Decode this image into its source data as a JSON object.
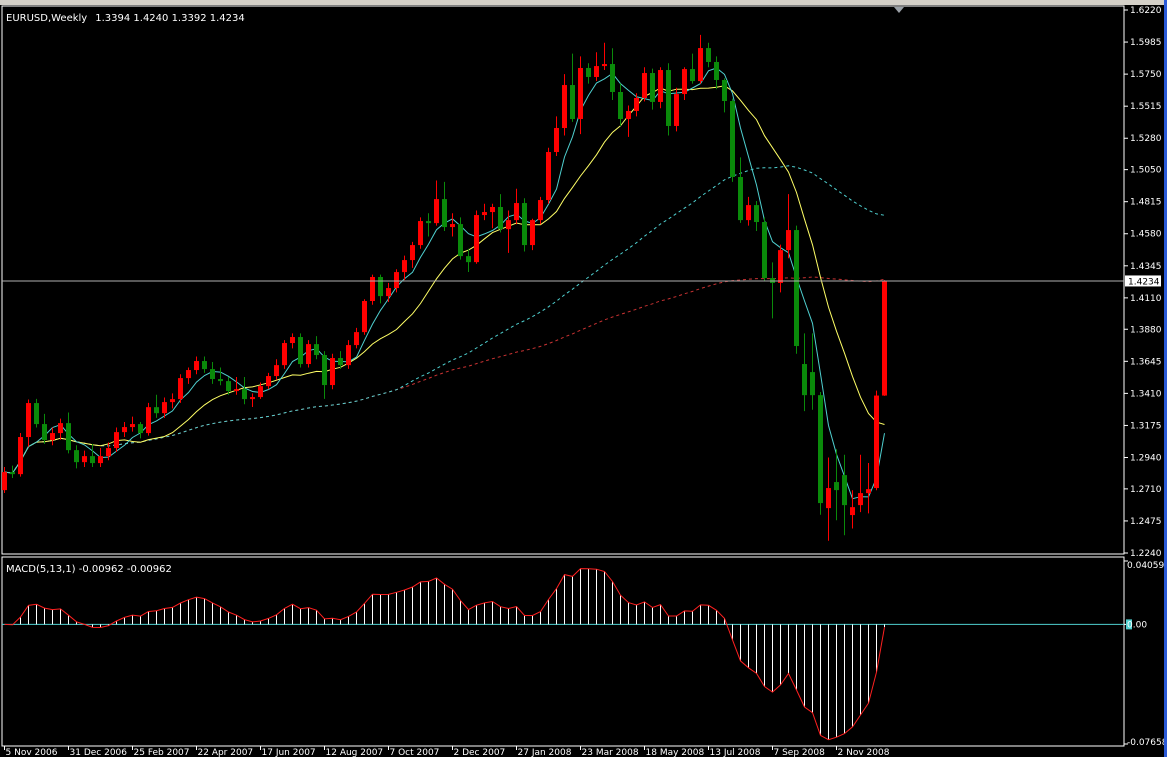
{
  "window": {
    "title_symbol": "EURUSD,Weekly",
    "title_ohlc": "1.3394 1.4240 1.3392 1.4234"
  },
  "colors": {
    "background": "#000000",
    "bull_candle": "#ff0000",
    "bear_candle": "#0a8a0a",
    "ma_fast": "#4fd0d0",
    "ma_medium": "#ffff66",
    "ma_slow_dashed": "#4fd0d0",
    "ma_long_dashed": "#c83232",
    "price_line": "#b0b0b0",
    "macd_histogram": "#ffffff",
    "macd_signal": "#ff2020",
    "macd_zero_line": "#4fd0d0"
  },
  "chart_data": [
    {
      "type": "candlestick",
      "title": "EURUSD,Weekly",
      "ylim": [
        1.224,
        1.622
      ],
      "y_ticks": [
        "1.6220",
        "1.5985",
        "1.5750",
        "1.5515",
        "1.5280",
        "1.5050",
        "1.4815",
        "1.4580",
        "1.4345",
        "1.4110",
        "1.3880",
        "1.3645",
        "1.3410",
        "1.3175",
        "1.2940",
        "1.2710",
        "1.2475",
        "1.2240"
      ],
      "current_price": "1.4234",
      "x_ticks": [
        "5 Nov 2006",
        "31 Dec 2006",
        "25 Feb 2007",
        "22 Apr 2007",
        "17 Jun 2007",
        "12 Aug 2007",
        "7 Oct 2007",
        "2 Dec 2007",
        "27 Jan 2008",
        "23 Mar 2008",
        "18 May 2008",
        "13 Jul 2008",
        "7 Sep 2008",
        "2 Nov 2008"
      ],
      "columns": [
        "open",
        "high",
        "low",
        "close"
      ],
      "ohlc": [
        [
          1.2701,
          1.287,
          1.268,
          1.2833
        ],
        [
          1.2833,
          1.288,
          1.279,
          1.2818
        ],
        [
          1.2818,
          1.312,
          1.28,
          1.309
        ],
        [
          1.309,
          1.3365,
          1.302,
          1.3339
        ],
        [
          1.3339,
          1.337,
          1.316,
          1.3185
        ],
        [
          1.3185,
          1.326,
          1.304,
          1.3068
        ],
        [
          1.3068,
          1.316,
          1.303,
          1.3119
        ],
        [
          1.3119,
          1.3225,
          1.307,
          1.3192
        ],
        [
          1.3192,
          1.327,
          1.297,
          1.2994
        ],
        [
          1.2994,
          1.303,
          1.286,
          1.2906
        ],
        [
          1.2906,
          1.299,
          1.287,
          1.295
        ],
        [
          1.295,
          1.304,
          1.287,
          1.2899
        ],
        [
          1.2899,
          1.301,
          1.287,
          1.295
        ],
        [
          1.295,
          1.305,
          1.292,
          1.3009
        ],
        [
          1.3009,
          1.316,
          1.298,
          1.3126
        ],
        [
          1.3126,
          1.32,
          1.309,
          1.3163
        ],
        [
          1.3163,
          1.324,
          1.313,
          1.3185
        ],
        [
          1.3185,
          1.32,
          1.308,
          1.3119
        ],
        [
          1.3119,
          1.334,
          1.31,
          1.3309
        ],
        [
          1.3309,
          1.34,
          1.323,
          1.3265
        ],
        [
          1.3265,
          1.338,
          1.323,
          1.3346
        ],
        [
          1.3346,
          1.341,
          1.33,
          1.3368
        ],
        [
          1.3368,
          1.355,
          1.334,
          1.3522
        ],
        [
          1.3522,
          1.36,
          1.348,
          1.3581
        ],
        [
          1.3581,
          1.368,
          1.355,
          1.3647
        ],
        [
          1.3647,
          1.368,
          1.356,
          1.3588
        ],
        [
          1.3588,
          1.364,
          1.348,
          1.3515
        ],
        [
          1.3515,
          1.36,
          1.347,
          1.35
        ],
        [
          1.35,
          1.353,
          1.34,
          1.3427
        ],
        [
          1.3427,
          1.353,
          1.34,
          1.3441
        ],
        [
          1.3441,
          1.353,
          1.333,
          1.3368
        ],
        [
          1.3368,
          1.341,
          1.331,
          1.3383
        ],
        [
          1.3383,
          1.349,
          1.337,
          1.3463
        ],
        [
          1.3463,
          1.356,
          1.344,
          1.3537
        ],
        [
          1.3537,
          1.366,
          1.351,
          1.3617
        ],
        [
          1.3617,
          1.38,
          1.359,
          1.3779
        ],
        [
          1.3779,
          1.385,
          1.374,
          1.3823
        ],
        [
          1.3823,
          1.385,
          1.36,
          1.3625
        ],
        [
          1.3625,
          1.38,
          1.36,
          1.3771
        ],
        [
          1.3771,
          1.383,
          1.366,
          1.3691
        ],
        [
          1.3691,
          1.372,
          1.337,
          1.3471
        ],
        [
          1.3471,
          1.37,
          1.344,
          1.3669
        ],
        [
          1.3669,
          1.372,
          1.359,
          1.3617
        ],
        [
          1.3617,
          1.38,
          1.359,
          1.3764
        ],
        [
          1.3764,
          1.389,
          1.374,
          1.3859
        ],
        [
          1.3859,
          1.41,
          1.384,
          1.4087
        ],
        [
          1.4087,
          1.428,
          1.406,
          1.4263
        ],
        [
          1.4263,
          1.428,
          1.407,
          1.4123
        ],
        [
          1.4123,
          1.422,
          1.408,
          1.4182
        ],
        [
          1.4182,
          1.432,
          1.415,
          1.4299
        ],
        [
          1.4299,
          1.442,
          1.424,
          1.4387
        ],
        [
          1.4387,
          1.452,
          1.433,
          1.4497
        ],
        [
          1.4497,
          1.47,
          1.447,
          1.4673
        ],
        [
          1.4673,
          1.473,
          1.456,
          1.4658
        ],
        [
          1.4658,
          1.497,
          1.464,
          1.4834
        ],
        [
          1.4834,
          1.496,
          1.46,
          1.4629
        ],
        [
          1.4629,
          1.473,
          1.456,
          1.4651
        ],
        [
          1.4651,
          1.47,
          1.439,
          1.4416
        ],
        [
          1.4416,
          1.447,
          1.43,
          1.4372
        ],
        [
          1.4372,
          1.475,
          1.436,
          1.4717
        ],
        [
          1.4717,
          1.48,
          1.468,
          1.4739
        ],
        [
          1.4739,
          1.48,
          1.462,
          1.4776
        ],
        [
          1.4776,
          1.487,
          1.459,
          1.4614
        ],
        [
          1.4614,
          1.475,
          1.444,
          1.468
        ],
        [
          1.468,
          1.491,
          1.465,
          1.4805
        ],
        [
          1.4805,
          1.484,
          1.445,
          1.4497
        ],
        [
          1.4497,
          1.469,
          1.446,
          1.468
        ],
        [
          1.468,
          1.485,
          1.465,
          1.4827
        ],
        [
          1.4827,
          1.521,
          1.48,
          1.5179
        ],
        [
          1.5179,
          1.544,
          1.515,
          1.5355
        ],
        [
          1.5355,
          1.575,
          1.53,
          1.567
        ],
        [
          1.567,
          1.59,
          1.54,
          1.5421
        ],
        [
          1.5421,
          1.588,
          1.531,
          1.5795
        ],
        [
          1.5795,
          1.583,
          1.568,
          1.5729
        ],
        [
          1.5729,
          1.591,
          1.57,
          1.5809
        ],
        [
          1.5809,
          1.598,
          1.578,
          1.5824
        ],
        [
          1.5824,
          1.594,
          1.556,
          1.5619
        ],
        [
          1.5619,
          1.568,
          1.537,
          1.5421
        ],
        [
          1.5421,
          1.552,
          1.529,
          1.548
        ],
        [
          1.548,
          1.561,
          1.544,
          1.5575
        ],
        [
          1.5575,
          1.58,
          1.555,
          1.5758
        ],
        [
          1.5758,
          1.579,
          1.549,
          1.5546
        ],
        [
          1.5546,
          1.58,
          1.55,
          1.578
        ],
        [
          1.578,
          1.583,
          1.53,
          1.537
        ],
        [
          1.537,
          1.565,
          1.533,
          1.5604
        ],
        [
          1.5604,
          1.58,
          1.556,
          1.5787
        ],
        [
          1.5787,
          1.59,
          1.568,
          1.5699
        ],
        [
          1.5699,
          1.6038,
          1.568,
          1.5941
        ],
        [
          1.5941,
          1.598,
          1.58,
          1.5839
        ],
        [
          1.5839,
          1.588,
          1.564,
          1.5707
        ],
        [
          1.5707,
          1.572,
          1.547,
          1.5553
        ],
        [
          1.5553,
          1.557,
          1.496,
          1.4996
        ],
        [
          1.4996,
          1.514,
          1.466,
          1.468
        ],
        [
          1.468,
          1.485,
          1.464,
          1.479
        ],
        [
          1.479,
          1.482,
          1.46,
          1.4666
        ],
        [
          1.4666,
          1.47,
          1.423,
          1.4255
        ],
        [
          1.4255,
          1.437,
          1.396,
          1.4219
        ],
        [
          1.4219,
          1.45,
          1.415,
          1.446
        ],
        [
          1.446,
          1.487,
          1.44,
          1.4607
        ],
        [
          1.4607,
          1.464,
          1.37,
          1.3757
        ],
        [
          1.3625,
          1.385,
          1.328,
          1.3397
        ],
        [
          1.3566,
          1.385,
          1.329,
          1.3397
        ],
        [
          1.3397,
          1.342,
          1.252,
          1.2606
        ],
        [
          1.2569,
          1.294,
          1.233,
          1.2716
        ],
        [
          1.276,
          1.3,
          1.248,
          1.2701
        ],
        [
          1.2811,
          1.296,
          1.237,
          1.2591
        ],
        [
          1.2518,
          1.27,
          1.242,
          1.2576
        ],
        [
          1.2591,
          1.296,
          1.254,
          1.2679
        ],
        [
          1.2679,
          1.29,
          1.253,
          1.2708
        ],
        [
          1.2716,
          1.343,
          1.27,
          1.3394
        ],
        [
          1.3394,
          1.424,
          1.3392,
          1.4234
        ]
      ]
    },
    {
      "type": "bar",
      "title": "MACD(5,13,1) -0.00962 -0.00962",
      "ylim": [
        -0.07658,
        0.04059
      ],
      "y_ticks": [
        "0.04059",
        "0.00",
        "-0.07658"
      ]
    }
  ]
}
